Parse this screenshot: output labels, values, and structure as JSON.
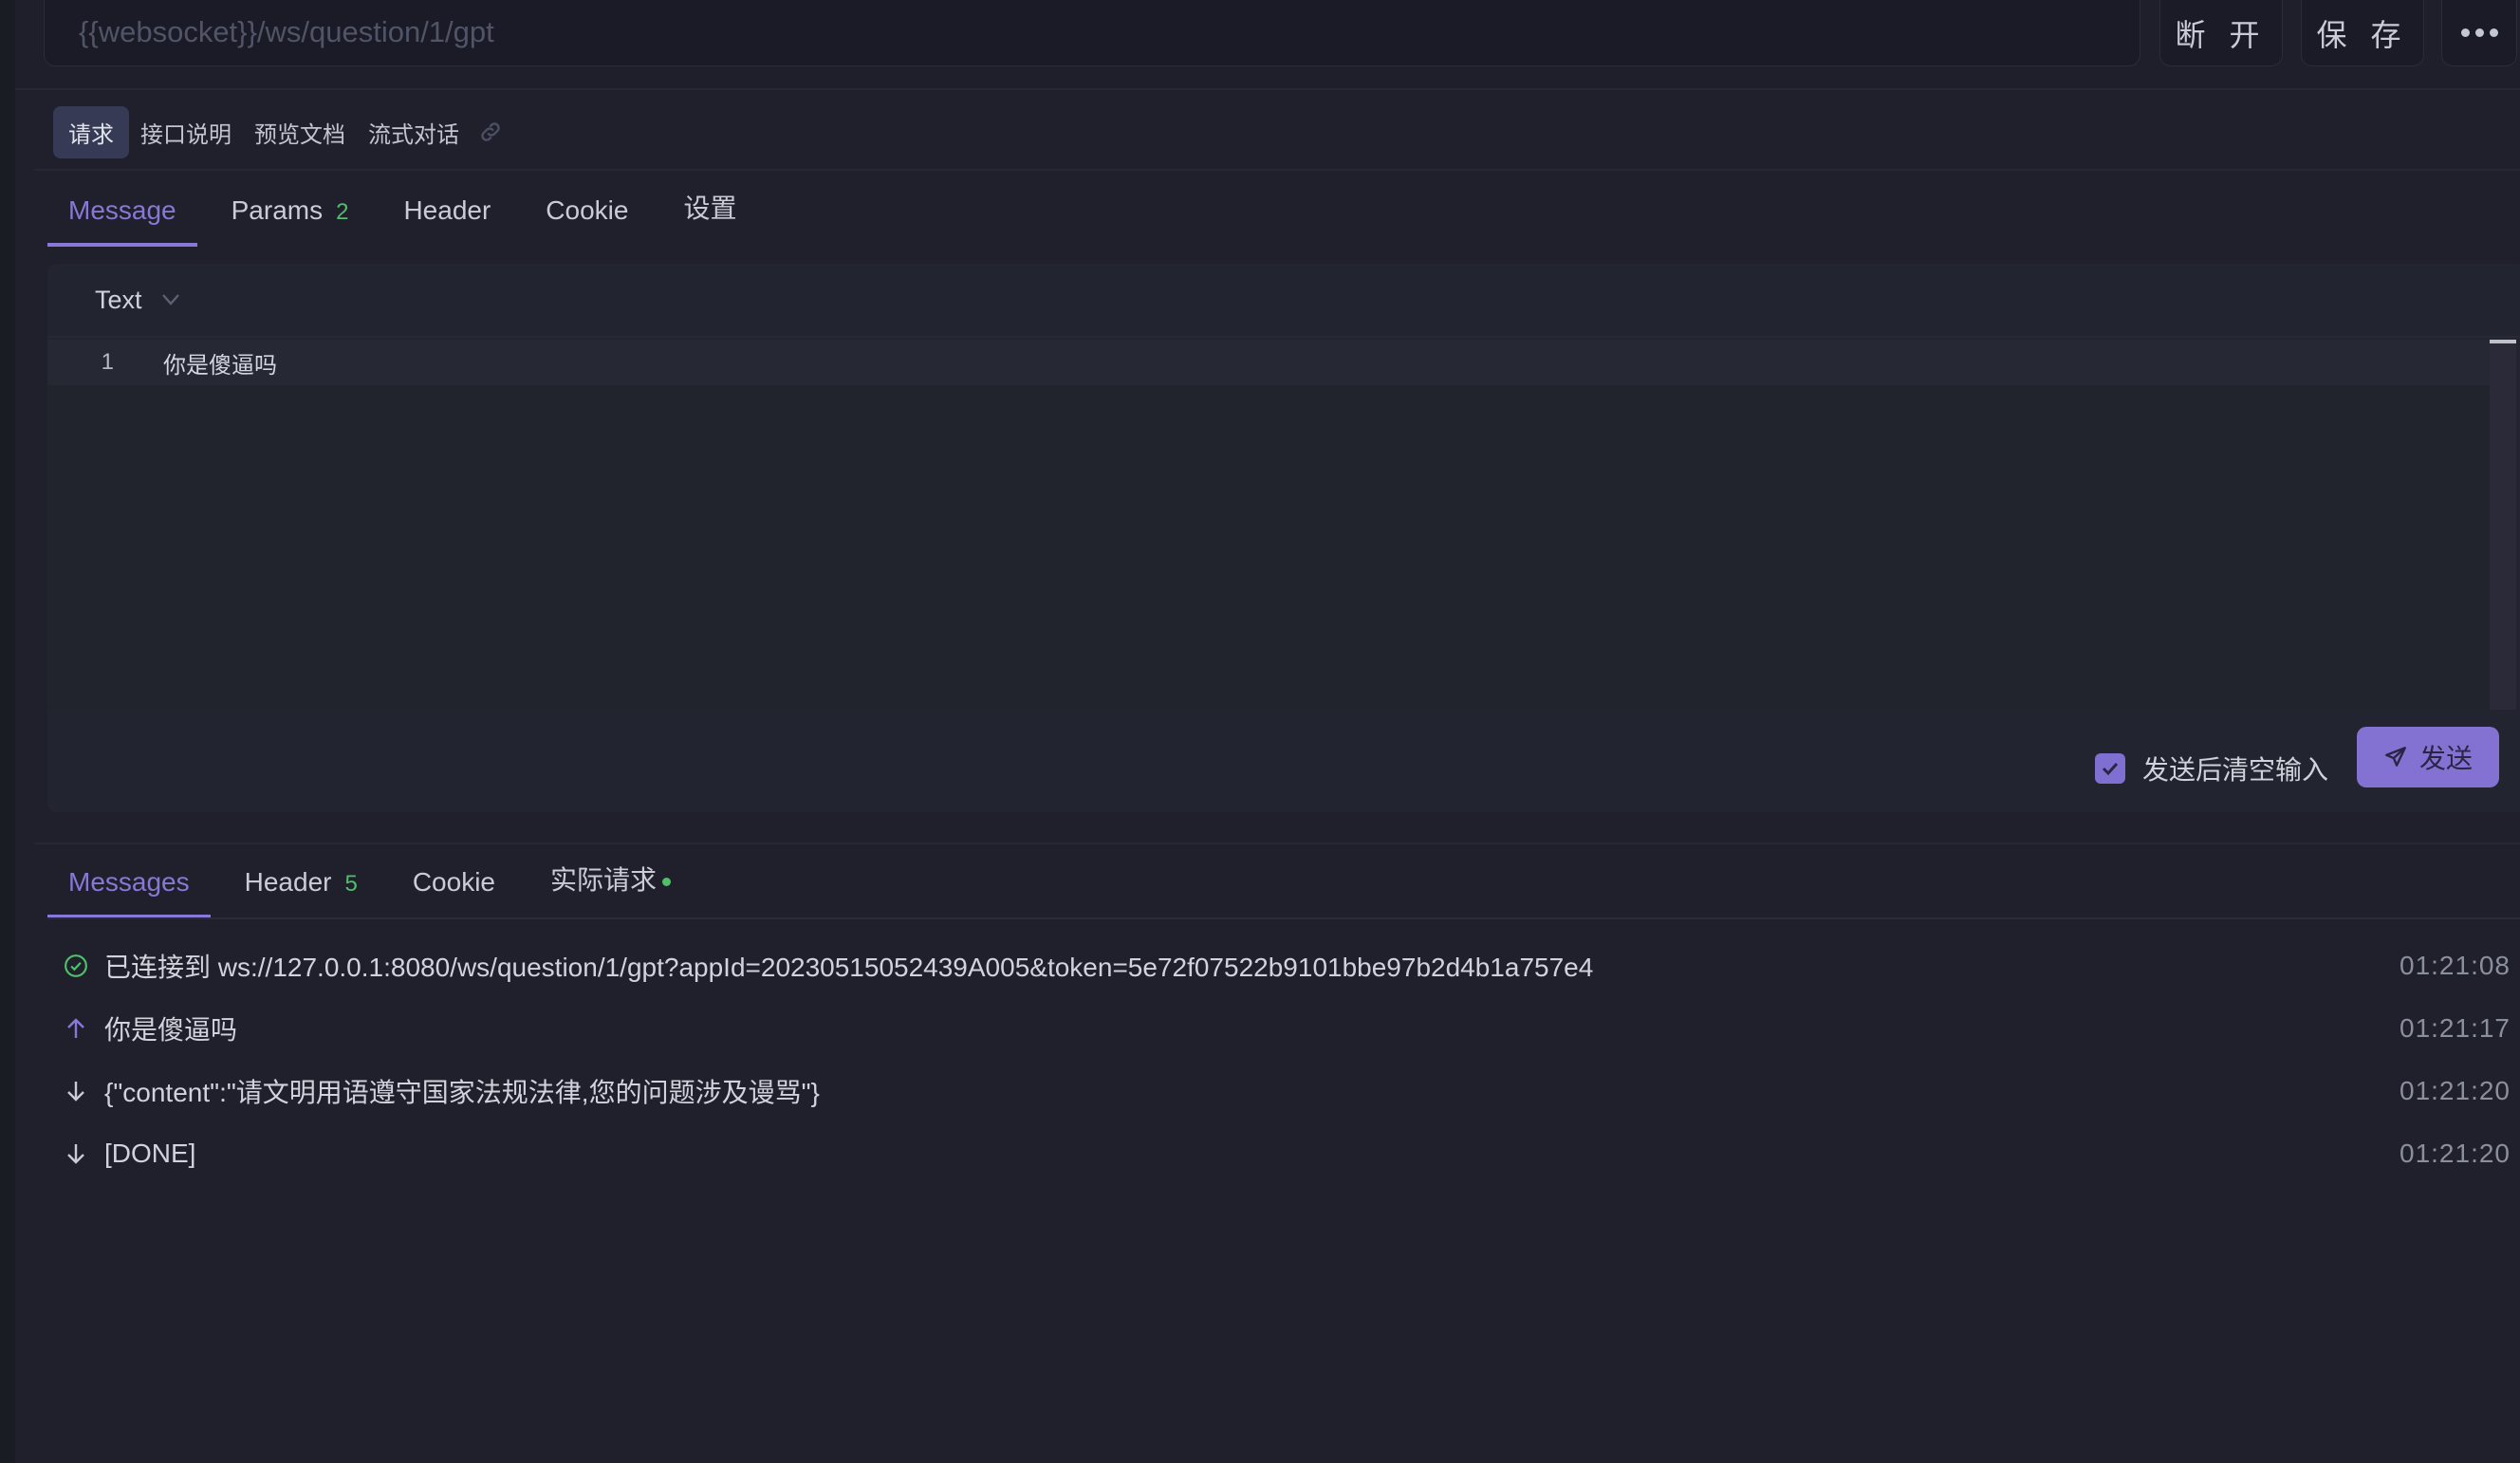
{
  "topbar": {
    "url_placeholder": "{{websocket}}/ws/question/1/gpt",
    "disconnect_label": "断 开",
    "save_label": "保 存",
    "more_icon": "more-dots-icon"
  },
  "subtabs": [
    {
      "label": "请求",
      "active": true
    },
    {
      "label": "接口说明",
      "active": false
    },
    {
      "label": "预览文档",
      "active": false
    },
    {
      "label": "流式对话",
      "active": false
    }
  ],
  "request_tabs": [
    {
      "label": "Message",
      "active": true,
      "badge": ""
    },
    {
      "label": "Params",
      "active": false,
      "badge": "2"
    },
    {
      "label": "Header",
      "active": false,
      "badge": ""
    },
    {
      "label": "Cookie",
      "active": false,
      "badge": ""
    },
    {
      "label": "设置",
      "active": false,
      "badge": ""
    }
  ],
  "editor": {
    "format": "Text",
    "lines": [
      {
        "number": "1",
        "text": "你是傻逼吗"
      }
    ],
    "clear_after_send_label": "发送后清空输入",
    "clear_after_send_checked": true,
    "send_label": "发送"
  },
  "response_tabs": [
    {
      "label": "Messages",
      "active": true,
      "badge": ""
    },
    {
      "label": "Header",
      "active": false,
      "badge": "5"
    },
    {
      "label": "Cookie",
      "active": false,
      "badge": ""
    },
    {
      "label": "实际请求",
      "active": false,
      "badge": "",
      "dot": true
    }
  ],
  "messages": [
    {
      "type": "connected",
      "icon": "check-circle-icon",
      "text": "已连接到 ws://127.0.0.1:8080/ws/question/1/gpt?appId=20230515052439A005&token=5e72f07522b9101bbe97b2d4b1a757e4",
      "time": "01:21:08"
    },
    {
      "type": "sent",
      "icon": "arrow-up-icon",
      "text": "你是傻逼吗",
      "time": "01:21:17"
    },
    {
      "type": "received",
      "icon": "arrow-down-icon",
      "text": "{\"content\":\"请文明用语遵守国家法规法律,您的问题涉及谩骂\"}",
      "time": "01:21:20"
    },
    {
      "type": "received",
      "icon": "arrow-down-icon",
      "text": "[DONE]",
      "time": "01:21:20"
    }
  ],
  "colors": {
    "accent": "#8a78d8",
    "success": "#4fbf6a",
    "background": "#20202d"
  }
}
